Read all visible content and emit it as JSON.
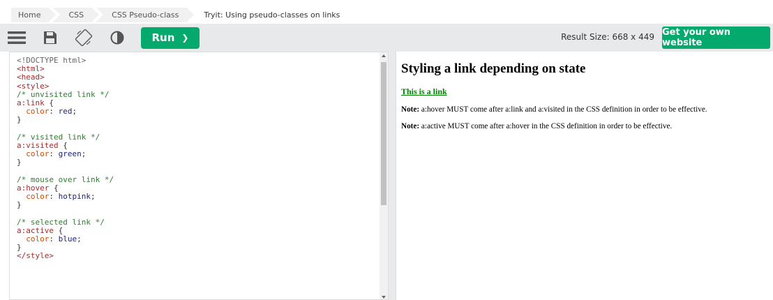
{
  "breadcrumb": {
    "items": [
      "Home",
      "CSS",
      "CSS Pseudo-class"
    ],
    "current": "Tryit: Using pseudo-classes on links"
  },
  "toolbar": {
    "icons": [
      "menu-icon",
      "save-icon",
      "rotate-icon",
      "theme-icon"
    ],
    "run_label": "Run",
    "run_arrow": "❯",
    "result_size": "Result Size: 668 x 449",
    "get_website": "Get your own website"
  },
  "code_lines": [
    "<!DOCTYPE html>",
    "<html>",
    "<head>",
    "<style>",
    "/* unvisited link */",
    "a:link {",
    "  color: red;",
    "}",
    "",
    "/* visited link */",
    "a:visited {",
    "  color: green;",
    "}",
    "",
    "/* mouse over link */",
    "a:hover {",
    "  color: hotpink;",
    "}",
    "",
    "/* selected link */",
    "a:active {",
    "  color: blue;",
    "}",
    "</style>"
  ],
  "result": {
    "heading": "Styling a link depending on state",
    "link_text": "This is a link",
    "note1_label": "Note:",
    "note1_text": " a:hover MUST come after a:link and a:visited in the CSS definition in order to be effective.",
    "note2_label": "Note:",
    "note2_text": " a:active MUST come after a:hover in the CSS definition in order to be effective."
  },
  "colors": {
    "accent": "#04aa6d",
    "toolbar_bg": "#e7e9eb",
    "link_visited": "#008000"
  }
}
